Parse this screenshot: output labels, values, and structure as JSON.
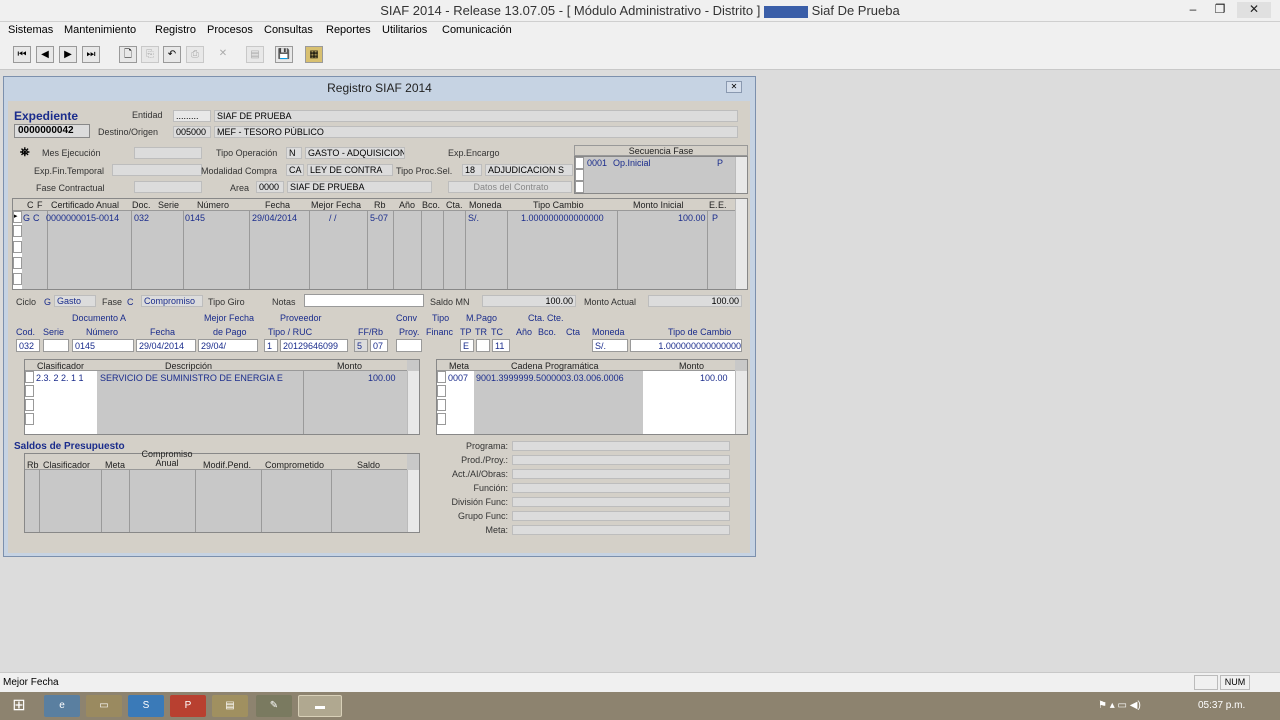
{
  "titlebar": {
    "title": "SIAF 2014 - Release 13.07.05 - [ Módulo Administrativo - Distrito ]",
    "env": "Siaf De Prueba",
    "min": "–",
    "restore": "❐",
    "close": "✕"
  },
  "menu": [
    "Sistemas",
    "Mantenimiento",
    "Registro",
    "Procesos",
    "Consultas",
    "Reportes",
    "Utilitarios",
    "Comunicación"
  ],
  "toolbar": {
    "first": "⏮",
    "prev": "◀",
    "next": "▶",
    "last": "⏭",
    "new": "🗋",
    "copy": "⎘",
    "undo": "↶",
    "print": "⎙",
    "delete": "✕",
    "edit": "▤",
    "save": "💾",
    "export": "▦"
  },
  "window": {
    "title": "Registro SIAF 2014",
    "close": "✕"
  },
  "header": {
    "expediente_label": "Expediente",
    "expediente_value": "0000000042",
    "entidad_label": "Entidad",
    "entidad_code": ".........",
    "entidad_name": "SIAF DE PRUEBA",
    "destino_label": "Destino/Origen",
    "destino_code": "005000",
    "destino_name": "MEF - TESORO PÚBLICO",
    "mes_label": "Mes Ejecución",
    "exp_fin_label": "Exp.Fin.Temporal",
    "fase_label": "Fase Contractual",
    "tipo_op_label": "Tipo Operación",
    "tipo_op_code": "N",
    "tipo_op_name": "GASTO - ADQUISICION DI",
    "modalidad_label": "Modalidad Compra",
    "modalidad_code": "CA",
    "modalidad_name": "LEY DE CONTRA",
    "tipo_proc_label": "Tipo Proc.Sel.",
    "tipo_proc_code": "18",
    "tipo_proc_name": "ADJUDICACION S",
    "area_label": "Area",
    "area_code": "0000",
    "area_name": "SIAF DE PRUEBA",
    "exp_encargo_label": "Exp.Encargo",
    "datos_contrato": "Datos del Contrato",
    "secuencia_label": "Secuencia Fase",
    "seq_code": "0001",
    "seq_name": "Op.Inicial",
    "seq_flag": "P"
  },
  "main_grid": {
    "headers": [
      "C",
      "F",
      "Certificado Anual",
      "Doc.",
      "Serie",
      "Número",
      "Fecha",
      "Mejor Fecha",
      "Rb",
      "Año",
      "Bco.",
      "Cta.",
      "Moneda",
      "Tipo Cambio",
      "Monto Inicial",
      "E.",
      "E."
    ],
    "row": [
      "G",
      "C",
      "0000000015-0014",
      "032",
      "",
      "0145",
      "29/04/2014",
      "/ /",
      "5-07",
      "",
      "",
      "",
      "S/.",
      "1.000000000000000",
      "100.00",
      "P",
      ""
    ]
  },
  "summary": {
    "ciclo_label": "Ciclo",
    "ciclo_code": "G",
    "ciclo_name": "Gasto",
    "fase_label": "Fase",
    "fase_code": "C",
    "fase_name": "Compromiso",
    "tipo_giro": "Tipo Giro",
    "notas": "Notas",
    "saldo_label": "Saldo MN",
    "saldo_value": "100.00",
    "monto_label": "Monto Actual",
    "monto_value": "100.00"
  },
  "documento": {
    "cod_label": "Cod.",
    "serie_label": "Serie",
    "doc_a_label": "Documento A",
    "numero_label": "Número",
    "fecha_label": "Fecha",
    "mejor_label": "Mejor Fecha",
    "de_pago": "de Pago",
    "proveedor_label": "Proveedor",
    "tipo_ruc_label": "Tipo / RUC",
    "ffrb_label": "FF/Rb",
    "conv_label": "Conv",
    "proy_label": "Proy.",
    "tipo_label": "Tipo",
    "financ_label": "Financ",
    "mpago_label": "M.Pago",
    "tp": "TP",
    "tr": "TR",
    "tc": "TC",
    "cta_cte_label": "Cta. Cte.",
    "ano_label": "Año",
    "bco_label": "Bco.",
    "cta_label": "Cta",
    "moneda_label": "Moneda",
    "tipo_cambio_label": "Tipo de Cambio",
    "cod": "032",
    "numero": "0145",
    "fecha": "29/04/2014",
    "mejor": "29/04/",
    "tipo": "1",
    "ruc": "20129646099",
    "ff": "5",
    "rb": "07",
    "tp_val": "E",
    "tc_val": "11",
    "moneda": "S/.",
    "tipo_cambio": "1.000000000000000"
  },
  "clasificador": {
    "h1": "Clasificador",
    "h2": "Descripción",
    "h3": "Monto",
    "code": "2.3. 2 2. 1 1",
    "desc": "SERVICIO DE SUMINISTRO DE ENERGIA E",
    "monto": "100.00"
  },
  "meta": {
    "h1": "Meta",
    "h2": "Cadena Programática",
    "h3": "Monto",
    "code": "0007",
    "cadena": "9001.3999999.5000003.03.006.0006",
    "monto": "100.00"
  },
  "saldos": {
    "title": "Saldos de Presupuesto",
    "headers": [
      "Rb",
      "Clasificador",
      "Meta",
      "Compromiso Anual",
      "Modif.Pend.",
      "Comprometido",
      "Saldo"
    ]
  },
  "programa": {
    "labels": [
      "Programa:",
      "Prod./Proy.:",
      "Act./AI/Obras:",
      "Función:",
      "División Func:",
      "Grupo Func:",
      "Meta:"
    ]
  },
  "status": {
    "text": "Mejor Fecha",
    "num": "NUM"
  },
  "taskbar": {
    "time": "05:37 p.m."
  }
}
